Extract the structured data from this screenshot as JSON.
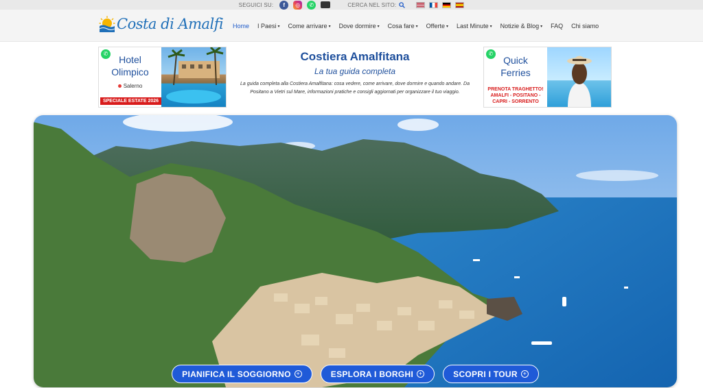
{
  "topbar": {
    "follow_label": "SEGUICI SU:",
    "search_label": "CERCA NEL SITO:",
    "social_icons": [
      "facebook-icon",
      "instagram-icon",
      "whatsapp-icon",
      "email-icon"
    ],
    "flags": [
      "us-flag",
      "fr-flag",
      "de-flag",
      "es-flag"
    ]
  },
  "header": {
    "logo_text": "Costa di Amalfi",
    "nav": [
      {
        "label": "Home",
        "active": true
      },
      {
        "label": "I Paesi",
        "dropdown": true
      },
      {
        "label": "Come arrivare",
        "dropdown": true
      },
      {
        "label": "Dove dormire",
        "dropdown": true
      },
      {
        "label": "Cosa fare",
        "dropdown": true
      },
      {
        "label": "Offerte",
        "dropdown": true
      },
      {
        "label": "Last Minute",
        "dropdown": true
      },
      {
        "label": "Notizie & Blog",
        "dropdown": true
      },
      {
        "label": "FAQ"
      },
      {
        "label": "Chi siamo"
      }
    ]
  },
  "promo_left": {
    "name_line1": "Hotel",
    "name_line2": "Olimpico",
    "city": "Salerno",
    "badge": "SPECIALE ESTATE 2026"
  },
  "promo_center": {
    "title": "Costiera Amalfitana",
    "subtitle": "La tua guida completa",
    "description": "La guida completa alla Costiera Amalfitana: cosa vedere, come arrivare, dove dormire e quando andare. Da Positano a Vietri sul Mare, informazioni pratiche e consigli aggiornati per organizzare il tuo viaggio."
  },
  "promo_right": {
    "name_line1": "Quick",
    "name_line2": "Ferries",
    "cta_line1": "PRENOTA TRAGHETTO!",
    "cta_line2": "AMALFI - POSITANO -",
    "cta_line3": "CAPRI - SORRENTO"
  },
  "hero": {
    "buttons": [
      "PIANIFICA IL SOGGIORNO",
      "ESPLORA I BORGHI",
      "SCOPRI I TOUR"
    ]
  },
  "colors": {
    "brand_blue": "#1e4f9c",
    "button_blue": "#1f5ad8",
    "nav_active": "#1e5ac8",
    "badge_red": "#d81b1b"
  }
}
